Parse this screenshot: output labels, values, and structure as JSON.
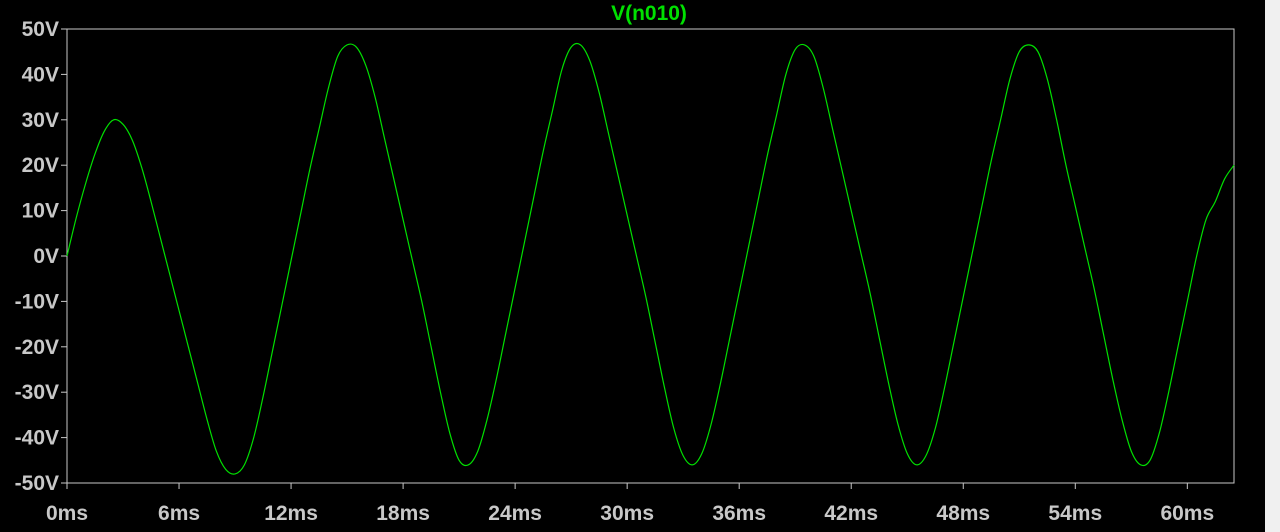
{
  "window": {
    "background": "#000000",
    "frame_color": "#c8c8c8",
    "right_strip_color": "#f0f0f0"
  },
  "chart_data": {
    "type": "line",
    "title": "V(n010)",
    "xlabel": "",
    "ylabel": "",
    "xlim": [
      0,
      62.5
    ],
    "ylim": [
      -50,
      50
    ],
    "x_unit": "ms",
    "y_unit": "V",
    "x_ticks": [
      0,
      6,
      12,
      18,
      24,
      30,
      36,
      42,
      48,
      54,
      60
    ],
    "x_tick_labels": [
      "0ms",
      "6ms",
      "12ms",
      "18ms",
      "24ms",
      "30ms",
      "36ms",
      "42ms",
      "48ms",
      "54ms",
      "60ms"
    ],
    "y_ticks": [
      50,
      40,
      30,
      20,
      10,
      0,
      -10,
      -20,
      -30,
      -40,
      -50
    ],
    "y_tick_labels": [
      "50V",
      "40V",
      "30V",
      "20V",
      "10V",
      "0V",
      "-10V",
      "-20V",
      "-30V",
      "-40V",
      "-50V"
    ],
    "grid": false,
    "series": [
      {
        "name": "V(n010)",
        "color": "#00e000",
        "points": [
          [
            0,
            0
          ],
          [
            0.5,
            8.5
          ],
          [
            1.0,
            16
          ],
          [
            1.5,
            22.5
          ],
          [
            2.0,
            27.5
          ],
          [
            2.5,
            30
          ],
          [
            3.0,
            29
          ],
          [
            3.5,
            25.5
          ],
          [
            4.0,
            19.5
          ],
          [
            4.5,
            12
          ],
          [
            5.0,
            4
          ],
          [
            5.5,
            -4
          ],
          [
            6.0,
            -12
          ],
          [
            6.5,
            -20
          ],
          [
            7.0,
            -28
          ],
          [
            7.5,
            -36
          ],
          [
            8.0,
            -43
          ],
          [
            8.5,
            -47
          ],
          [
            9.0,
            -48
          ],
          [
            9.5,
            -46
          ],
          [
            10.0,
            -40
          ],
          [
            10.5,
            -31
          ],
          [
            11.0,
            -21
          ],
          [
            11.5,
            -11
          ],
          [
            12.0,
            -1
          ],
          [
            12.5,
            9
          ],
          [
            13.0,
            19
          ],
          [
            13.5,
            28
          ],
          [
            14.0,
            37
          ],
          [
            14.5,
            44
          ],
          [
            15.0,
            46.5
          ],
          [
            15.5,
            46
          ],
          [
            16.0,
            42
          ],
          [
            16.5,
            35
          ],
          [
            17.0,
            26
          ],
          [
            17.5,
            17
          ],
          [
            18.0,
            8
          ],
          [
            18.5,
            -1
          ],
          [
            19.0,
            -10
          ],
          [
            19.5,
            -20
          ],
          [
            20.0,
            -30
          ],
          [
            20.5,
            -39
          ],
          [
            21.0,
            -45
          ],
          [
            21.5,
            -46
          ],
          [
            22.0,
            -43
          ],
          [
            22.5,
            -36
          ],
          [
            23.0,
            -27
          ],
          [
            23.5,
            -17
          ],
          [
            24.0,
            -7
          ],
          [
            24.5,
            3
          ],
          [
            25.0,
            13
          ],
          [
            25.5,
            23
          ],
          [
            26.0,
            32
          ],
          [
            26.5,
            41
          ],
          [
            27.0,
            46
          ],
          [
            27.5,
            46.5
          ],
          [
            28.0,
            43
          ],
          [
            28.5,
            36
          ],
          [
            29.0,
            27
          ],
          [
            29.5,
            18
          ],
          [
            30.0,
            9
          ],
          [
            30.5,
            0
          ],
          [
            31.0,
            -9
          ],
          [
            31.5,
            -19
          ],
          [
            32.0,
            -29
          ],
          [
            32.5,
            -38
          ],
          [
            33.0,
            -44
          ],
          [
            33.5,
            -46
          ],
          [
            34.0,
            -43.5
          ],
          [
            34.5,
            -37
          ],
          [
            35.0,
            -28
          ],
          [
            35.5,
            -18
          ],
          [
            36.0,
            -8
          ],
          [
            36.5,
            2
          ],
          [
            37.0,
            12
          ],
          [
            37.5,
            22
          ],
          [
            38.0,
            31
          ],
          [
            38.5,
            40
          ],
          [
            39.0,
            45.5
          ],
          [
            39.5,
            46.5
          ],
          [
            40.0,
            44
          ],
          [
            40.5,
            37
          ],
          [
            41.0,
            28
          ],
          [
            41.5,
            19
          ],
          [
            42.0,
            10
          ],
          [
            42.5,
            1
          ],
          [
            43.0,
            -8
          ],
          [
            43.5,
            -18
          ],
          [
            44.0,
            -28
          ],
          [
            44.5,
            -37
          ],
          [
            45.0,
            -43.5
          ],
          [
            45.5,
            -46
          ],
          [
            46.0,
            -44
          ],
          [
            46.5,
            -38
          ],
          [
            47.0,
            -29
          ],
          [
            47.5,
            -19
          ],
          [
            48.0,
            -9
          ],
          [
            48.5,
            1
          ],
          [
            49.0,
            11
          ],
          [
            49.5,
            21
          ],
          [
            50.0,
            30
          ],
          [
            50.5,
            39
          ],
          [
            51.0,
            45
          ],
          [
            51.5,
            46.5
          ],
          [
            52.0,
            45
          ],
          [
            52.5,
            39
          ],
          [
            53.0,
            30
          ],
          [
            53.5,
            20
          ],
          [
            54.0,
            11
          ],
          [
            54.5,
            2
          ],
          [
            55.0,
            -7
          ],
          [
            55.5,
            -17
          ],
          [
            56.0,
            -27
          ],
          [
            56.5,
            -36
          ],
          [
            57.0,
            -43
          ],
          [
            57.5,
            -46
          ],
          [
            58.0,
            -45
          ],
          [
            58.5,
            -39
          ],
          [
            59.0,
            -30
          ],
          [
            59.5,
            -20
          ],
          [
            60.0,
            -10
          ],
          [
            60.5,
            0
          ],
          [
            61.0,
            8
          ],
          [
            61.5,
            12
          ],
          [
            62.0,
            17
          ],
          [
            62.5,
            20
          ]
        ]
      }
    ]
  }
}
